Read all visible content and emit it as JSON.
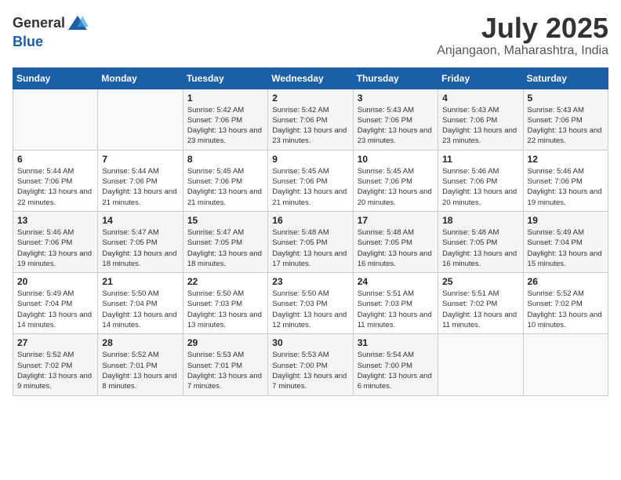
{
  "header": {
    "logo": {
      "text_general": "General",
      "text_blue": "Blue"
    },
    "month_year": "July 2025",
    "location": "Anjangaon, Maharashtra, India"
  },
  "calendar": {
    "days_of_week": [
      "Sunday",
      "Monday",
      "Tuesday",
      "Wednesday",
      "Thursday",
      "Friday",
      "Saturday"
    ],
    "weeks": [
      [
        {
          "day": "",
          "info": ""
        },
        {
          "day": "",
          "info": ""
        },
        {
          "day": "1",
          "info": "Sunrise: 5:42 AM\nSunset: 7:06 PM\nDaylight: 13 hours and 23 minutes."
        },
        {
          "day": "2",
          "info": "Sunrise: 5:42 AM\nSunset: 7:06 PM\nDaylight: 13 hours and 23 minutes."
        },
        {
          "day": "3",
          "info": "Sunrise: 5:43 AM\nSunset: 7:06 PM\nDaylight: 13 hours and 23 minutes."
        },
        {
          "day": "4",
          "info": "Sunrise: 5:43 AM\nSunset: 7:06 PM\nDaylight: 13 hours and 23 minutes."
        },
        {
          "day": "5",
          "info": "Sunrise: 5:43 AM\nSunset: 7:06 PM\nDaylight: 13 hours and 22 minutes."
        }
      ],
      [
        {
          "day": "6",
          "info": "Sunrise: 5:44 AM\nSunset: 7:06 PM\nDaylight: 13 hours and 22 minutes."
        },
        {
          "day": "7",
          "info": "Sunrise: 5:44 AM\nSunset: 7:06 PM\nDaylight: 13 hours and 21 minutes."
        },
        {
          "day": "8",
          "info": "Sunrise: 5:45 AM\nSunset: 7:06 PM\nDaylight: 13 hours and 21 minutes."
        },
        {
          "day": "9",
          "info": "Sunrise: 5:45 AM\nSunset: 7:06 PM\nDaylight: 13 hours and 21 minutes."
        },
        {
          "day": "10",
          "info": "Sunrise: 5:45 AM\nSunset: 7:06 PM\nDaylight: 13 hours and 20 minutes."
        },
        {
          "day": "11",
          "info": "Sunrise: 5:46 AM\nSunset: 7:06 PM\nDaylight: 13 hours and 20 minutes."
        },
        {
          "day": "12",
          "info": "Sunrise: 5:46 AM\nSunset: 7:06 PM\nDaylight: 13 hours and 19 minutes."
        }
      ],
      [
        {
          "day": "13",
          "info": "Sunrise: 5:46 AM\nSunset: 7:06 PM\nDaylight: 13 hours and 19 minutes."
        },
        {
          "day": "14",
          "info": "Sunrise: 5:47 AM\nSunset: 7:05 PM\nDaylight: 13 hours and 18 minutes."
        },
        {
          "day": "15",
          "info": "Sunrise: 5:47 AM\nSunset: 7:05 PM\nDaylight: 13 hours and 18 minutes."
        },
        {
          "day": "16",
          "info": "Sunrise: 5:48 AM\nSunset: 7:05 PM\nDaylight: 13 hours and 17 minutes."
        },
        {
          "day": "17",
          "info": "Sunrise: 5:48 AM\nSunset: 7:05 PM\nDaylight: 13 hours and 16 minutes."
        },
        {
          "day": "18",
          "info": "Sunrise: 5:48 AM\nSunset: 7:05 PM\nDaylight: 13 hours and 16 minutes."
        },
        {
          "day": "19",
          "info": "Sunrise: 5:49 AM\nSunset: 7:04 PM\nDaylight: 13 hours and 15 minutes."
        }
      ],
      [
        {
          "day": "20",
          "info": "Sunrise: 5:49 AM\nSunset: 7:04 PM\nDaylight: 13 hours and 14 minutes."
        },
        {
          "day": "21",
          "info": "Sunrise: 5:50 AM\nSunset: 7:04 PM\nDaylight: 13 hours and 14 minutes."
        },
        {
          "day": "22",
          "info": "Sunrise: 5:50 AM\nSunset: 7:03 PM\nDaylight: 13 hours and 13 minutes."
        },
        {
          "day": "23",
          "info": "Sunrise: 5:50 AM\nSunset: 7:03 PM\nDaylight: 13 hours and 12 minutes."
        },
        {
          "day": "24",
          "info": "Sunrise: 5:51 AM\nSunset: 7:03 PM\nDaylight: 13 hours and 11 minutes."
        },
        {
          "day": "25",
          "info": "Sunrise: 5:51 AM\nSunset: 7:02 PM\nDaylight: 13 hours and 11 minutes."
        },
        {
          "day": "26",
          "info": "Sunrise: 5:52 AM\nSunset: 7:02 PM\nDaylight: 13 hours and 10 minutes."
        }
      ],
      [
        {
          "day": "27",
          "info": "Sunrise: 5:52 AM\nSunset: 7:02 PM\nDaylight: 13 hours and 9 minutes."
        },
        {
          "day": "28",
          "info": "Sunrise: 5:52 AM\nSunset: 7:01 PM\nDaylight: 13 hours and 8 minutes."
        },
        {
          "day": "29",
          "info": "Sunrise: 5:53 AM\nSunset: 7:01 PM\nDaylight: 13 hours and 7 minutes."
        },
        {
          "day": "30",
          "info": "Sunrise: 5:53 AM\nSunset: 7:00 PM\nDaylight: 13 hours and 7 minutes."
        },
        {
          "day": "31",
          "info": "Sunrise: 5:54 AM\nSunset: 7:00 PM\nDaylight: 13 hours and 6 minutes."
        },
        {
          "day": "",
          "info": ""
        },
        {
          "day": "",
          "info": ""
        }
      ]
    ]
  }
}
